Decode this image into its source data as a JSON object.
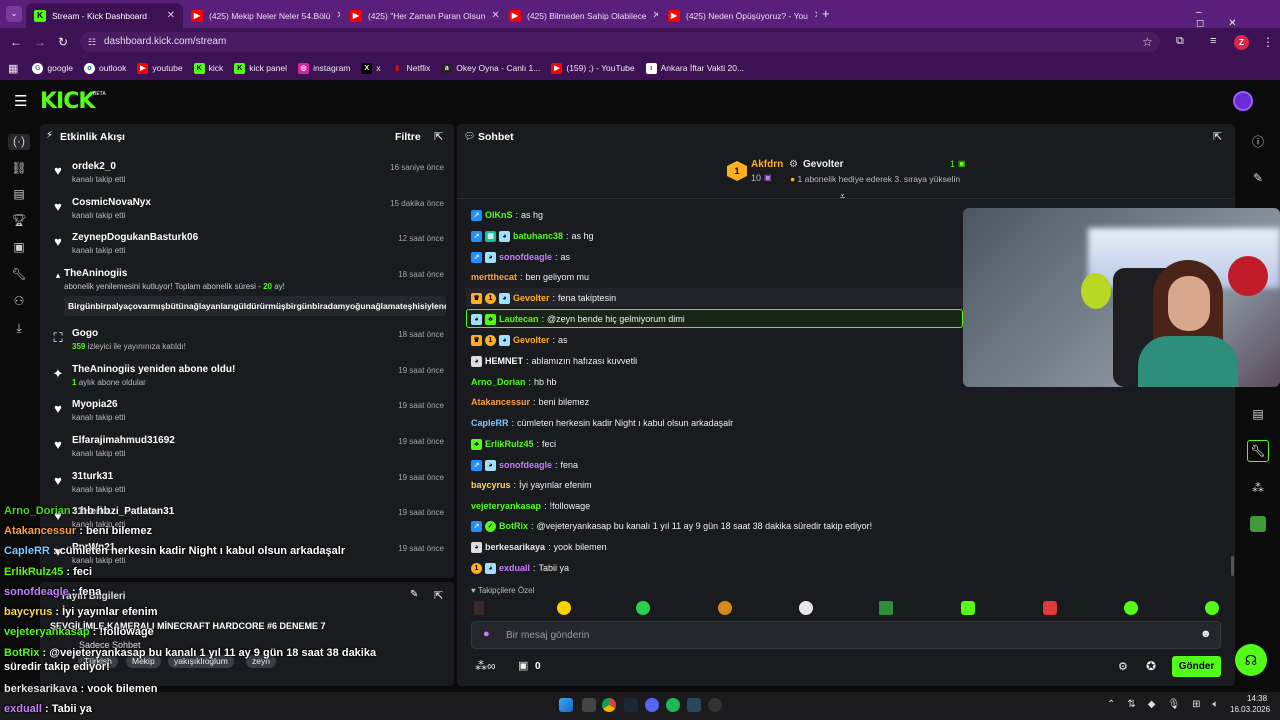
{
  "browser": {
    "tabs": [
      {
        "label": "Stream - Kick Dashboard"
      },
      {
        "label": "(425) Mekip Neler Neler 54.Bölü"
      },
      {
        "label": "(425) \"Her Zaman Paran Olsun"
      },
      {
        "label": "(425) Bilmeden Sahip Olabilece"
      },
      {
        "label": "(425) Neden Öpüşüyoruz? - You"
      }
    ],
    "url": "dashboard.kick.com/stream",
    "profile_initial": "Z",
    "bookmarks": [
      "google",
      "outlook",
      "youtube",
      "kick",
      "kick panel",
      "instagram",
      "x",
      "Netflix",
      "Okey Oyna - Canlı 1...",
      "(159) ;) - YouTube",
      "Ankara İftar Vakti 20..."
    ]
  },
  "kick": {
    "logo": "KICK",
    "beta": "BETA"
  },
  "activity": {
    "title": "Etkinlik Akışı",
    "filter": "Filtre",
    "items": [
      {
        "name": "ordek2_0",
        "sub": "kanalı takip etti",
        "time": "16 saniye önce"
      },
      {
        "name": "CosmicNovaNyx",
        "sub": "kanalı takip etti",
        "time": "15 dakika önce"
      },
      {
        "name": "ZeynepDogukanBasturk06",
        "sub": "kanalı takip etti",
        "time": "12 saat önce"
      },
      {
        "name": "TheAninogiis",
        "sub": "abonelik yenilemesini kutluyor! Toplam abonelik süresi -",
        "sub_value": "20",
        "sub_unit": "ay!",
        "message": "Birgünbirpalyaçovarmışbütünağlayanlarıgüldürürmüşbirgünbiradamyoğunağlamateşhisiylendokto",
        "time": "18 saat önce"
      },
      {
        "name": "Gogo",
        "sub_value": "359",
        "sub": "izleyici ile yayınınıza katıldı!",
        "time": "18 saat önce"
      },
      {
        "name": "TheAninogiis yeniden abone oldu!",
        "sub_value": "1",
        "sub": "aylık abone oldular",
        "time": "19 saat önce"
      },
      {
        "name": "Myopia26",
        "sub": "kanalı takip etti",
        "time": "19 saat önce"
      },
      {
        "name": "Elfarajimahmud31692",
        "sub": "kanalı takip etti",
        "time": "19 saat önce"
      },
      {
        "name": "31turk31",
        "sub": "kanalı takip etti",
        "time": "19 saat önce"
      },
      {
        "name": "31Herkazi_Patlatan31",
        "sub": "kanalı takip etti",
        "time": "19 saat önce"
      },
      {
        "name": "PnrWn21",
        "sub": "kanalı takip etti",
        "time": "19 saat önce"
      }
    ]
  },
  "stream_info": {
    "title": "SEVGİLİMLE KAMERALI MİNECRAFT HARDCORE #6 DENEME 7",
    "category": "Yayın Bilgileri",
    "chat_mode": "Sadece Sohbet",
    "tags": [
      "Türkish",
      "Mekip",
      "yakışıklıoğlum",
      "zeyn"
    ]
  },
  "chat": {
    "title": "Sohbet",
    "leader1": {
      "name": "Akfdrn",
      "count": "1",
      "sub": "10"
    },
    "leader2": {
      "name": "Gevolter",
      "count": "1",
      "note": "1 abonelik hediye ederek 3. sıraya yükselin"
    },
    "messages": [
      {
        "user": "OlKnS",
        "text": "as hg",
        "color": "#53fc18"
      },
      {
        "user": "batuhanc38",
        "text": "as hg",
        "color": "#53fc18"
      },
      {
        "user": "sonofdeagle",
        "text": "as",
        "color": "#c77dff"
      },
      {
        "user": "mertthecat",
        "text": "ben geliyom mu",
        "color": "#ff9f43"
      },
      {
        "user": "Gevolter",
        "text": "fena takiptesin",
        "color": "#ffb020"
      },
      {
        "user": "Lautecan",
        "text": "@zeyn bende hiç gelmiyorum dimi",
        "color": "#53fc18"
      },
      {
        "user": "Gevolter",
        "text": "as",
        "color": "#ffb020"
      },
      {
        "user": "HEMNET",
        "text": "ablamızın hafızası kuvvetli",
        "color": "#ffffff"
      },
      {
        "user": "Arno_Dorian",
        "text": "hb hb",
        "color": "#53fc18"
      },
      {
        "user": "Atakancessur",
        "text": "beni bilemez",
        "color": "#ff9f43"
      },
      {
        "user": "CapleRR",
        "text": "cümleten herkesin kadir Night ı kabul olsun arkadaşalr",
        "color": "#7ec8ff"
      },
      {
        "user": "ErlikRulz45",
        "text": "feci",
        "color": "#53fc18"
      },
      {
        "user": "sonofdeagle",
        "text": "fena",
        "color": "#c77dff"
      },
      {
        "user": "baycyrus",
        "text": "İyi yayınlar efenim",
        "color": "#ffd84d"
      },
      {
        "user": "vejeteryankasap",
        "text": "!followage",
        "color": "#53fc18"
      },
      {
        "user": "BotRix",
        "text": "@vejeteryankasap bu kanalı 1 yıl 11 ay 9 gün 18 saat 38 dakika süredir takip ediyor!",
        "color": "#53fc18"
      },
      {
        "user": "berkesarikaya",
        "text": "yook bilemen",
        "color": "#e5e5e5"
      },
      {
        "user": "exduall",
        "text": "Tabii ya",
        "color": "#c77dff"
      }
    ],
    "emote_section": "Takipçilere Özel",
    "input_placeholder": "Bir mesaj gönderin",
    "points": "0",
    "send": "Gönder"
  },
  "overlay_chat": [
    {
      "user": "Arno_Dorian",
      "text": "hb hb",
      "color": "#53fc18"
    },
    {
      "user": "Atakancessur",
      "text": "beni bilemez",
      "color": "#ff9f43"
    },
    {
      "user": "CapleRR",
      "text": "cümleten herkesin kadir Night ı kabul olsun arkadaşalr",
      "color": "#7ec8ff"
    },
    {
      "user": "ErlikRulz45",
      "text": "feci",
      "color": "#53fc18"
    },
    {
      "user": "sonofdeagle",
      "text": "fena",
      "color": "#c77dff"
    },
    {
      "user": "baycyrus",
      "text": "İyi yayınlar efenim",
      "color": "#ffd84d"
    },
    {
      "user": "vejeteryankasap",
      "text": "!followage",
      "color": "#53fc18"
    },
    {
      "user": "BotRix",
      "text": "@vejeteryankasap bu kanalı 1 yıl 11 ay 9 gün 18 saat 38 dakika süredir takip ediyor!",
      "color": "#53fc18"
    },
    {
      "user": "berkesarikaya",
      "text": "yook bilemen",
      "color": "#e5e5e5"
    },
    {
      "user": "exduall",
      "text": "Tabii ya",
      "color": "#c77dff"
    }
  ],
  "taskbar": {
    "time": "14:38",
    "date": "16.03.2026"
  },
  "colors": {
    "kick_green": "#53fc18",
    "browser_purple": "#5a1f7a",
    "panel": "#191b1f"
  }
}
